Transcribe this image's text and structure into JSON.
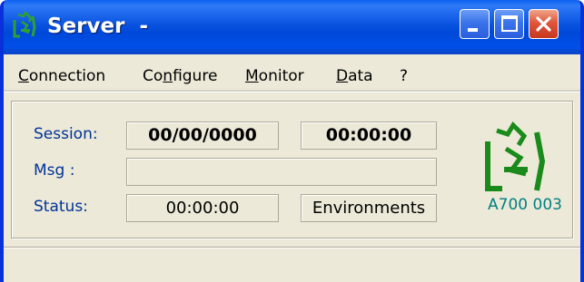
{
  "window": {
    "title": "Server  -",
    "icon": "server-app-icon",
    "controls": {
      "minimize": "minimize-icon",
      "maximize": "maximize-icon",
      "close": "close-icon"
    }
  },
  "menu": {
    "items": [
      {
        "label": "Connection",
        "mnemonic": "C",
        "rest": "onnection"
      },
      {
        "label": "Configure",
        "pre": "Co",
        "mnemonic": "n",
        "rest": "figure"
      },
      {
        "label": "Monitor",
        "mnemonic": "M",
        "rest": "onitor"
      },
      {
        "label": "Data",
        "mnemonic": "D",
        "rest": "ata"
      },
      {
        "label": "?"
      }
    ]
  },
  "panel": {
    "session_label": "Session:",
    "session_date": "00/00/0000",
    "session_time": "00:00:00",
    "msg_label": "Msg :",
    "msg_value": "",
    "status_label": "Status:",
    "status_time": "00:00:00",
    "status_text": "Environments",
    "device_id": "A700  003",
    "device_icon": "device-logo-icon"
  },
  "colors": {
    "titlebar": "#0a53e0",
    "label_text": "#003399",
    "device_id_text": "#008080",
    "logo_green": "#1a8a1a",
    "window_bg": "#ece9d8"
  }
}
